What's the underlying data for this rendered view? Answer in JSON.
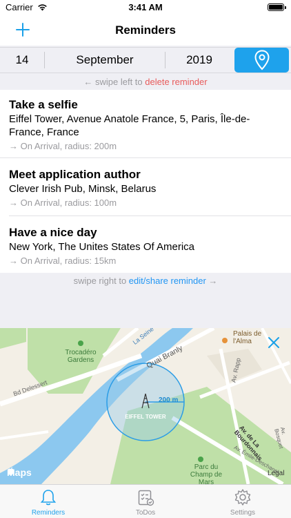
{
  "status_bar": {
    "carrier": "Carrier",
    "time": "3:41 AM"
  },
  "nav": {
    "title": "Reminders",
    "add_icon": "plus-icon"
  },
  "date_bar": {
    "day": "14",
    "month": "September",
    "year": "2019",
    "location_icon": "location-pin-icon",
    "accent": "#1ea2ec"
  },
  "hints": {
    "top_prefix": "← swipe left to ",
    "top_action": "delete reminder",
    "bottom_prefix": "swipe right to ",
    "bottom_action": "edit/share reminder",
    "bottom_suffix": " →"
  },
  "reminders": [
    {
      "title": "Take a selfie",
      "address": "Eiffel Tower, Avenue Anatole France, 5, Paris, Île-de-France, France",
      "meta": "→ On Arrival, radius: 200m"
    },
    {
      "title": "Meet application author",
      "address": "Clever Irish Pub, Minsk, Belarus",
      "meta": "→ On Arrival, radius: 100m"
    },
    {
      "title": "Have a nice day",
      "address": "New York, The Unites States Of America",
      "meta": "→ On Arrival, radius: 15km"
    }
  ],
  "map": {
    "logo": "Maps",
    "radius_label": "200 m",
    "pin_label": "EIFFEL TOWER",
    "labels": {
      "trocadero": "Trocadéro Gardens",
      "seine": "La Seine",
      "quai": "Quai Branly",
      "palais": "Palais de l'Alma",
      "rapp": "Av. Rapp",
      "delessert": "Bd Delessert",
      "bourdonnais": "Av. de La Bourdonnais",
      "champ": "Parc du Champ de Mars",
      "emile": "Av. Émile-Deschanel",
      "bosquet": "Av. Bosquet",
      "legal": "Legal"
    },
    "close_icon": "close-icon"
  },
  "tabs": [
    {
      "label": "Reminders",
      "icon": "bell-icon",
      "active": true
    },
    {
      "label": "ToDos",
      "icon": "checklist-icon",
      "active": false
    },
    {
      "label": "Settings",
      "icon": "gear-icon",
      "active": false
    }
  ]
}
